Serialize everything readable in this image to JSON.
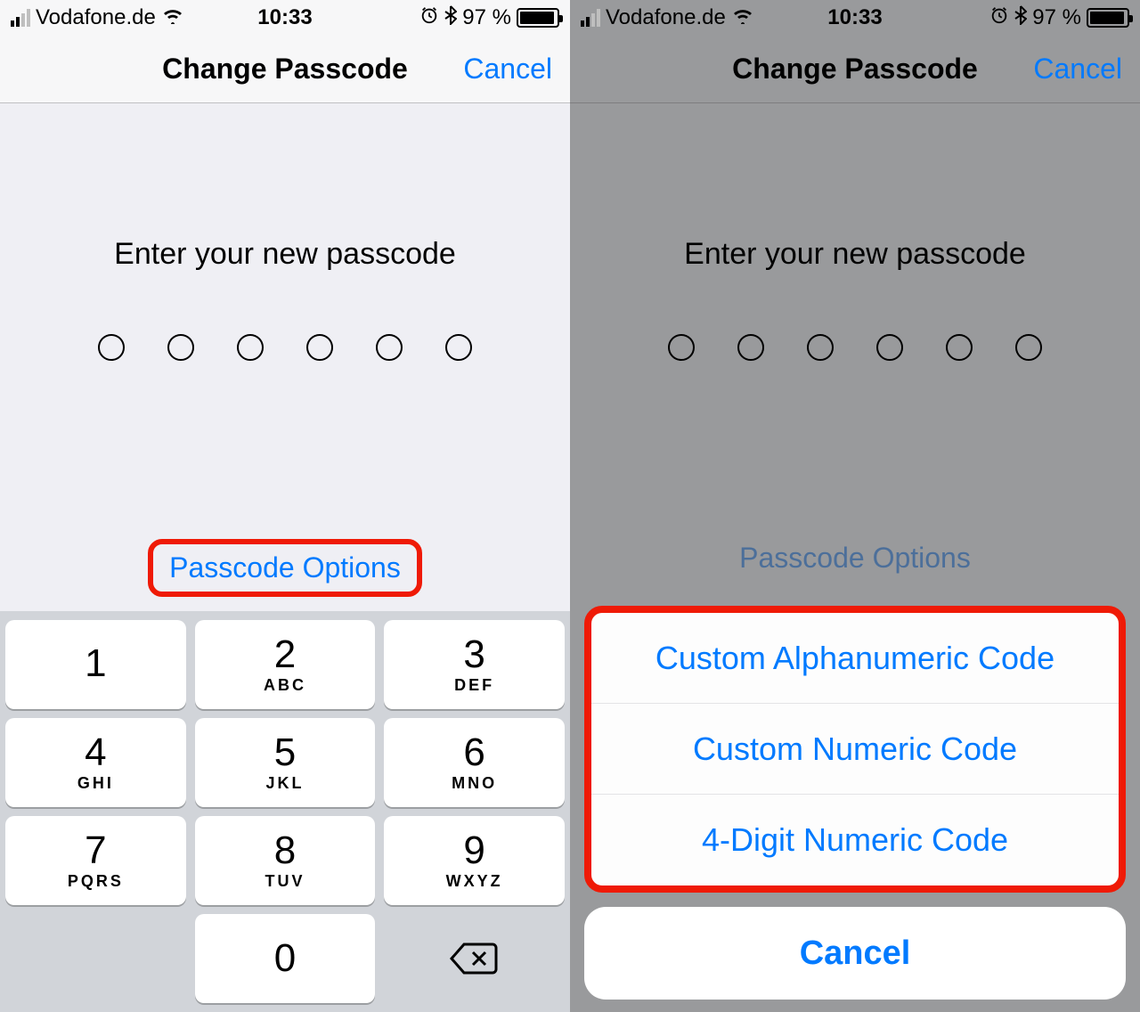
{
  "status": {
    "carrier": "Vodafone.de",
    "time": "10:33",
    "battery_pct": "97 %"
  },
  "nav": {
    "title": "Change Passcode",
    "cancel": "Cancel"
  },
  "content": {
    "prompt": "Enter your new passcode",
    "options_link": "Passcode Options"
  },
  "keypad": {
    "keys": [
      {
        "num": "1",
        "letters": ""
      },
      {
        "num": "2",
        "letters": "ABC"
      },
      {
        "num": "3",
        "letters": "DEF"
      },
      {
        "num": "4",
        "letters": "GHI"
      },
      {
        "num": "5",
        "letters": "JKL"
      },
      {
        "num": "6",
        "letters": "MNO"
      },
      {
        "num": "7",
        "letters": "PQRS"
      },
      {
        "num": "8",
        "letters": "TUV"
      },
      {
        "num": "9",
        "letters": "WXYZ"
      },
      {
        "num": "0",
        "letters": ""
      }
    ]
  },
  "sheet": {
    "options": [
      "Custom Alphanumeric Code",
      "Custom Numeric Code",
      "4-Digit Numeric Code"
    ],
    "cancel": "Cancel"
  }
}
